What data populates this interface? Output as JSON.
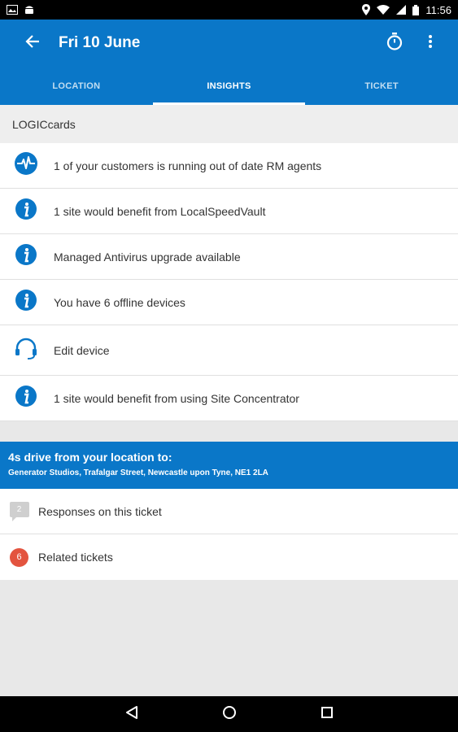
{
  "status_bar": {
    "time": "11:56",
    "left_icons": [
      "image-icon",
      "android-icon"
    ],
    "right_icons": [
      "location-icon",
      "wifi-icon",
      "signal-icon",
      "battery-icon"
    ]
  },
  "app_bar": {
    "title": "Fri 10 June",
    "back_icon": "arrow-left-icon",
    "actions": [
      "stopwatch-icon",
      "overflow-menu-icon"
    ],
    "color": "#0a77c8"
  },
  "tabs": [
    {
      "label": "LOCATION",
      "active": false
    },
    {
      "label": "INSIGHTS",
      "active": true
    },
    {
      "label": "TICKET",
      "active": false
    }
  ],
  "insights": {
    "section_title": "LOGICcards",
    "items": [
      {
        "icon": "pulse-icon",
        "text": "1 of your customers is running out of date RM agents"
      },
      {
        "icon": "info-icon",
        "text": "1 site would benefit from LocalSpeedVault"
      },
      {
        "icon": "info-icon",
        "text": "Managed Antivirus upgrade available"
      },
      {
        "icon": "info-icon",
        "text": "You have 6 offline devices"
      },
      {
        "icon": "headset-icon",
        "text": "Edit device"
      },
      {
        "icon": "info-icon",
        "text": "1 site would benefit from using Site Concentrator"
      }
    ]
  },
  "drive": {
    "title": "4s drive from your location to:",
    "address": "Generator Studios, Trafalgar Street, Newcastle upon Tyne, NE1 2LA"
  },
  "ticket": {
    "responses": {
      "count": "2",
      "label": "Responses on this ticket"
    },
    "related": {
      "count": "6",
      "label": "Related tickets"
    }
  },
  "nav_bar": [
    "back-triangle-icon",
    "home-circle-icon",
    "recents-square-icon"
  ]
}
